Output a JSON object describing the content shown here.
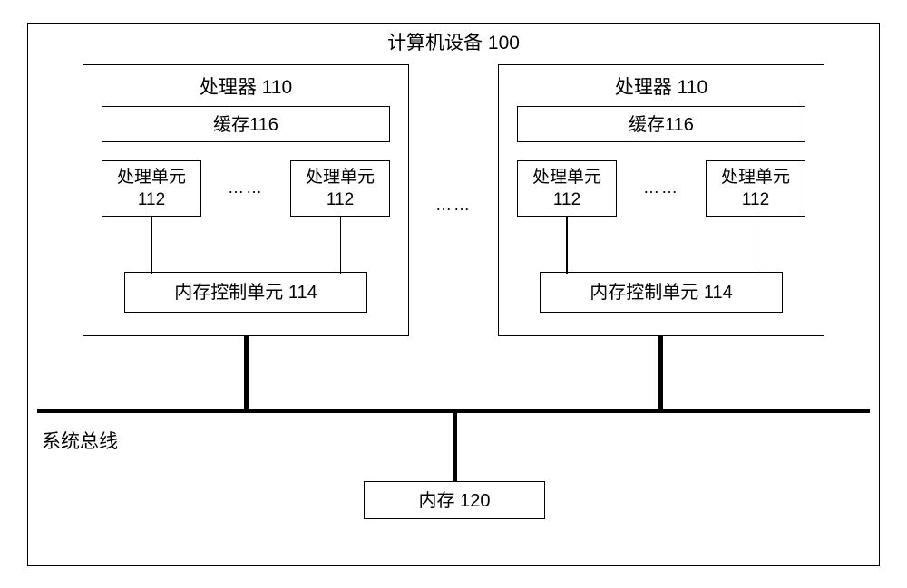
{
  "outer": {
    "title": "计算机设备 100"
  },
  "processor": {
    "title": "处理器 110",
    "cache": "缓存116",
    "pu_label": "处理单元",
    "pu_num": "112",
    "pu_ellipsis": "……",
    "mem_ctrl": "内存控制单元  114"
  },
  "gap_ellipsis": "……",
  "bus_label": "系统总线",
  "memory": "内存 120"
}
